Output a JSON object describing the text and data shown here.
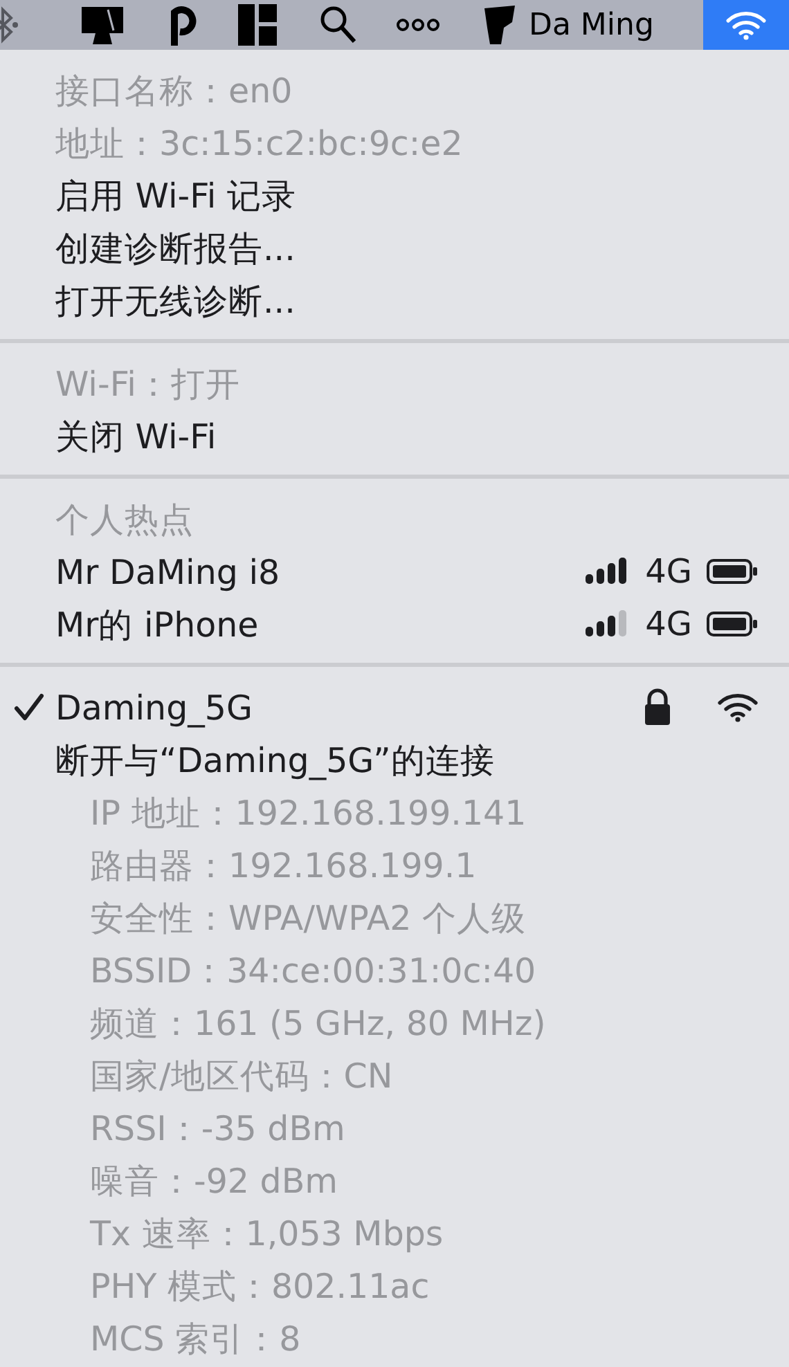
{
  "menu_bar": {
    "user_name": "Da Ming",
    "wifi_item": {
      "selected": true
    }
  },
  "sections": [
    {
      "items": [
        {
          "kind": "item",
          "label": "接口名称：en0",
          "disabled": true
        },
        {
          "kind": "item",
          "label": "地址：3c:15:c2:bc:9c:e2",
          "disabled": true
        },
        {
          "kind": "item",
          "label": "启用 Wi-Fi 记录",
          "disabled": false
        },
        {
          "kind": "item",
          "label": "创建诊断报告...",
          "disabled": false
        },
        {
          "kind": "item",
          "label": "打开无线诊断...",
          "disabled": false
        }
      ]
    },
    {
      "items": [
        {
          "kind": "item",
          "label": "Wi-Fi：打开",
          "disabled": true
        },
        {
          "kind": "item",
          "label": "关闭 Wi-Fi",
          "disabled": false
        }
      ]
    },
    {
      "items": [
        {
          "kind": "item",
          "label": "个人热点",
          "disabled": true
        },
        {
          "kind": "hotspot",
          "label": "Mr DaMing i8",
          "full_signal": true,
          "network_type": "4G"
        },
        {
          "kind": "hotspot",
          "label": "Mr的 iPhone",
          "full_signal": false,
          "network_type": "4G"
        }
      ]
    },
    {
      "items": [
        {
          "kind": "network",
          "label": "Daming_5G",
          "checked": true,
          "locked": true
        },
        {
          "kind": "item",
          "label": "断开与“Daming_5G”的连接",
          "disabled": false
        },
        {
          "kind": "detail",
          "label": "IP 地址：192.168.199.141"
        },
        {
          "kind": "detail",
          "label": "路由器：192.168.199.1"
        },
        {
          "kind": "detail",
          "label": "安全性：WPA/WPA2 个人级"
        },
        {
          "kind": "detail",
          "label": "BSSID：34:ce:00:31:0c:40"
        },
        {
          "kind": "detail",
          "label": "频道：161 (5 GHz, 80 MHz)"
        },
        {
          "kind": "detail",
          "label": "国家/地区代码：CN"
        },
        {
          "kind": "detail",
          "label": "RSSI：-35 dBm"
        },
        {
          "kind": "detail",
          "label": "噪音：-92 dBm"
        },
        {
          "kind": "detail",
          "label": "Tx 速率：1,053 Mbps"
        },
        {
          "kind": "detail",
          "label": "PHY 模式：802.11ac"
        },
        {
          "kind": "detail",
          "label": "MCS 索引：8"
        }
      ]
    }
  ]
}
